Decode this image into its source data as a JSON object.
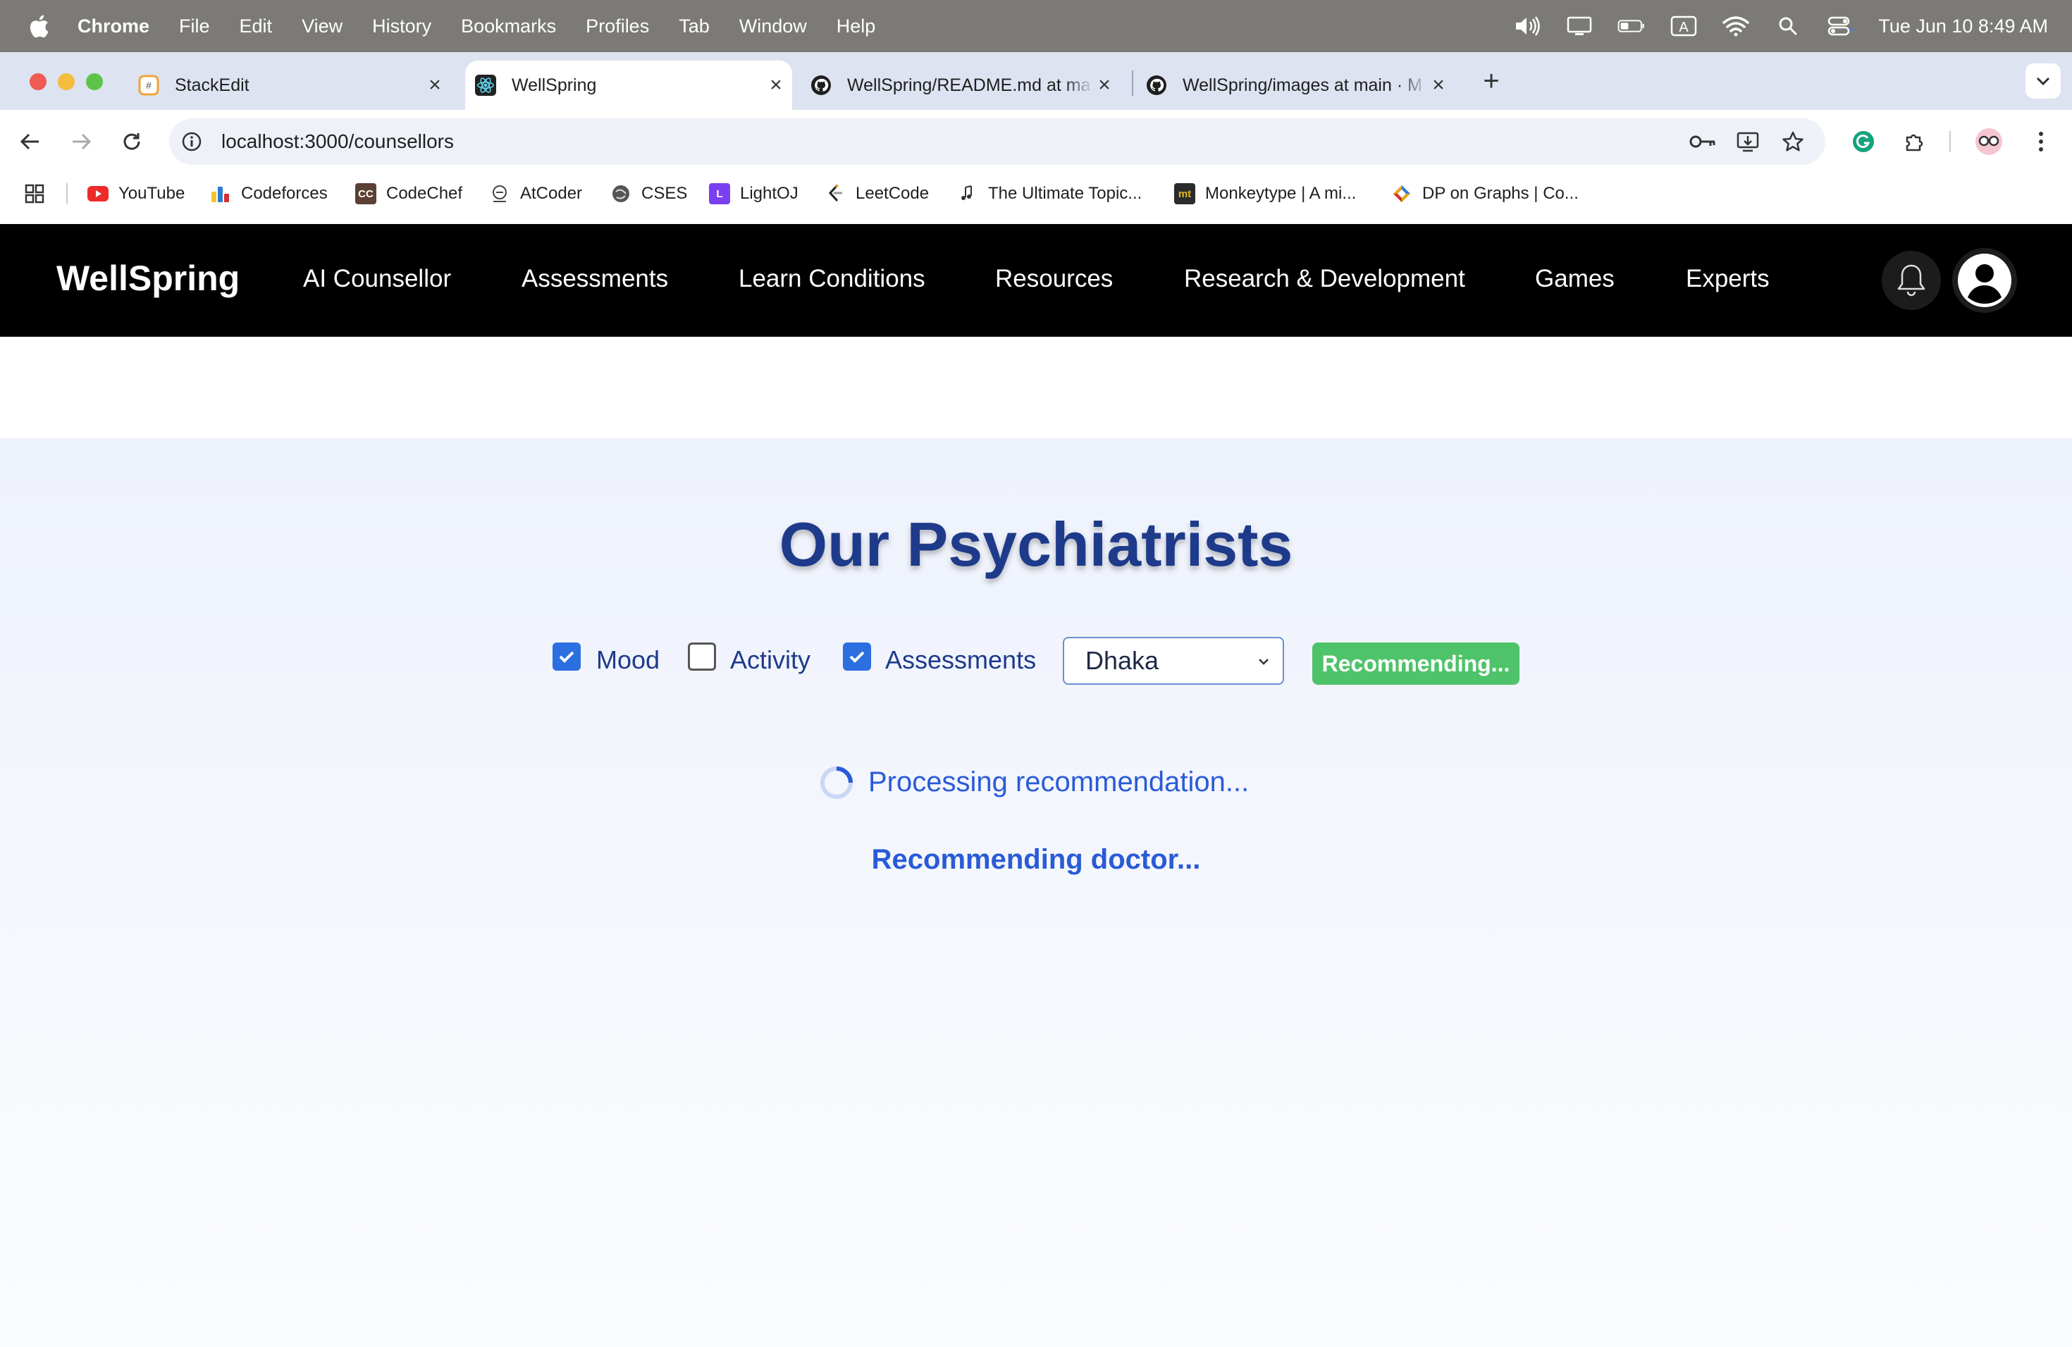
{
  "menubar": {
    "app_name": "Chrome",
    "items": [
      "File",
      "Edit",
      "View",
      "History",
      "Bookmarks",
      "Profiles",
      "Tab",
      "Window",
      "Help"
    ],
    "clock": "Tue Jun 10  8:49 AM"
  },
  "tabs": [
    {
      "title": "StackEdit",
      "icon": "stackedit-icon"
    },
    {
      "title": "WellSpring",
      "icon": "react-icon",
      "active": true
    },
    {
      "title": "WellSpring/README.md at ma",
      "icon": "github-icon"
    },
    {
      "title": "WellSpring/images at main · M",
      "icon": "github-icon"
    }
  ],
  "omnibox": {
    "url": "localhost:3000/counsellors"
  },
  "bookmarks": [
    {
      "label": "YouTube",
      "icon": "youtube-icon"
    },
    {
      "label": "Codeforces",
      "icon": "codeforces-icon"
    },
    {
      "label": "CodeChef",
      "icon": "codechef-icon",
      "icon_text": "CC"
    },
    {
      "label": "AtCoder",
      "icon": "atcoder-icon"
    },
    {
      "label": "CSES",
      "icon": "cses-icon"
    },
    {
      "label": "LightOJ",
      "icon": "lightoj-icon",
      "icon_text": "L"
    },
    {
      "label": "LeetCode",
      "icon": "leetcode-icon"
    },
    {
      "label": "The Ultimate Topic...",
      "icon": "music-note-icon"
    },
    {
      "label": "Monkeytype | A mi...",
      "icon": "monkeytype-icon",
      "icon_text": "mt"
    },
    {
      "label": "DP on Graphs | Co...",
      "icon": "codeforces-icon"
    }
  ],
  "nav": {
    "brand": "WellSpring",
    "links": [
      "AI Counsellor",
      "Assessments",
      "Learn Conditions",
      "Resources",
      "Research & Development",
      "Games",
      "Experts"
    ]
  },
  "page": {
    "title": "Our Psychiatrists",
    "filters": [
      {
        "label": "Mood",
        "checked": true
      },
      {
        "label": "Activity",
        "checked": false
      },
      {
        "label": "Assessments",
        "checked": true
      }
    ],
    "location_select": {
      "value": "Dhaka"
    },
    "recommend_button": "Recommending...",
    "processing_text": "Processing recommendation...",
    "status_text": "Recommending doctor..."
  },
  "colors": {
    "title": "#1e3a8a",
    "accent_blue": "#2a5bd7",
    "button_green": "#4fc36a",
    "nav_bg": "#000000"
  }
}
